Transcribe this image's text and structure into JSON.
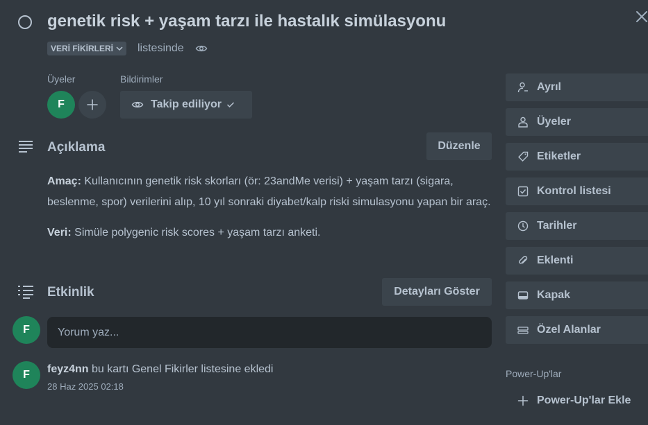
{
  "card": {
    "title": "genetik risk + yaşam tarzı ile hastalık simülasyonu",
    "list_name": "VERİ FİKİRLERİ",
    "list_suffix": "listesinde"
  },
  "members": {
    "label": "Üyeler",
    "avatar_initial": "F",
    "avatar_color": "#1f845a"
  },
  "notifications": {
    "label": "Bildirimler",
    "watch_label": "Takip ediliyor"
  },
  "description": {
    "heading": "Açıklama",
    "edit_label": "Düzenle",
    "p1_label": "Amaç:",
    "p1_text": "Kullanıcının genetik risk skorları (ör: 23andMe verisi) + yaşam tarzı (sigara, beslenme, spor) verilerini alıp, 10 yıl sonraki diyabet/kalp riski simulasyonu yapan bir araç.",
    "p2_label": "Veri:",
    "p2_text": "Simüle polygenic risk scores + yaşam tarzı anketi."
  },
  "activity": {
    "heading": "Etkinlik",
    "details_label": "Detayları Göster",
    "comment_placeholder": "Yorum yaz...",
    "entries": [
      {
        "avatar_initial": "F",
        "user": "feyz4nn",
        "text": "bu kartı Genel Fikirler listesine ekledi",
        "time": "28 Haz 2025 02:18"
      }
    ]
  },
  "sidebar": {
    "buttons": [
      {
        "label": "Ayrıl",
        "icon": "person-leave-icon"
      },
      {
        "label": "Üyeler",
        "icon": "person-icon"
      },
      {
        "label": "Etiketler",
        "icon": "tag-icon"
      },
      {
        "label": "Kontrol listesi",
        "icon": "checklist-icon"
      },
      {
        "label": "Tarihler",
        "icon": "clock-icon"
      },
      {
        "label": "Eklenti",
        "icon": "paperclip-icon"
      },
      {
        "label": "Kapak",
        "icon": "card-cover-icon"
      },
      {
        "label": "Özel Alanlar",
        "icon": "custom-fields-icon"
      }
    ],
    "powerups_label": "Power-Up'lar",
    "powerups_add": "Power-Up'lar Ekle"
  },
  "colors": {
    "background": "#323940",
    "button": "#3b444c",
    "input": "#22272b",
    "text": "#b6c2cf"
  }
}
